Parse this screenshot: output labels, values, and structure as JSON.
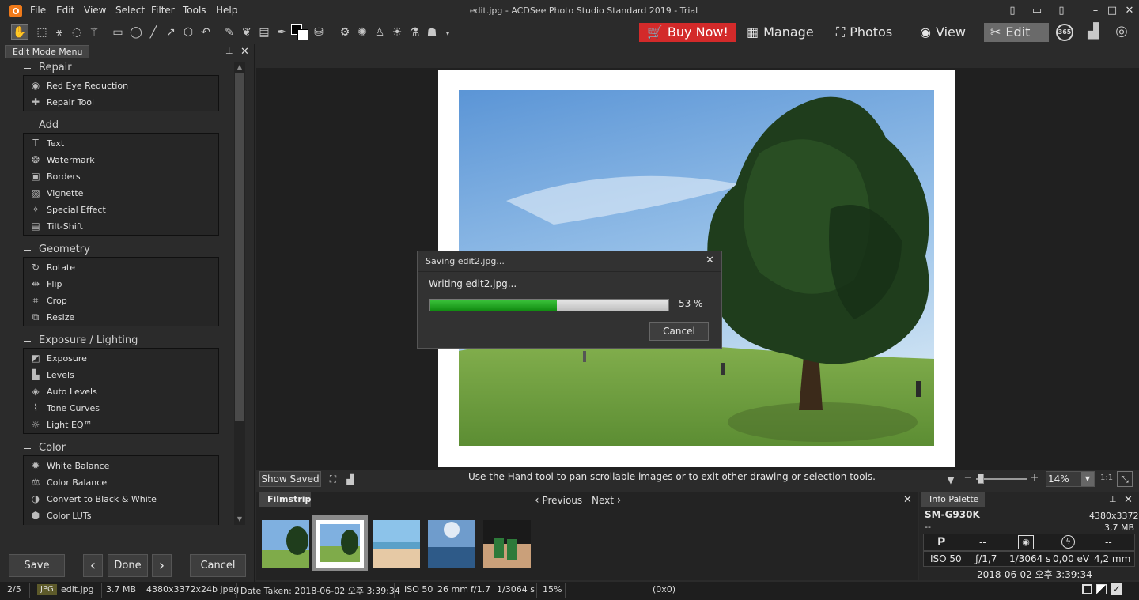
{
  "window": {
    "title": "edit.jpg - ACDSee Photo Studio Standard 2019 - Trial",
    "menu": [
      "File",
      "Edit",
      "View",
      "Select",
      "Filter",
      "Tools",
      "Help"
    ]
  },
  "modes": {
    "buy_now": "Buy Now!",
    "manage": "Manage",
    "photos": "Photos",
    "view": "View",
    "edit": "Edit",
    "badge_365": "365"
  },
  "panel": {
    "tab": "Edit Mode Menu",
    "sections": [
      {
        "title": "Repair",
        "items": [
          {
            "label": "Red Eye Reduction",
            "icon": "eye-icon"
          },
          {
            "label": "Repair Tool",
            "icon": "bandage-icon"
          }
        ]
      },
      {
        "title": "Add",
        "items": [
          {
            "label": "Text",
            "icon": "text-icon"
          },
          {
            "label": "Watermark",
            "icon": "watermark-icon"
          },
          {
            "label": "Borders",
            "icon": "borders-icon"
          },
          {
            "label": "Vignette",
            "icon": "vignette-icon"
          },
          {
            "label": "Special Effect",
            "icon": "wand-icon"
          },
          {
            "label": "Tilt-Shift",
            "icon": "tilt-shift-icon"
          }
        ]
      },
      {
        "title": "Geometry",
        "items": [
          {
            "label": "Rotate",
            "icon": "rotate-icon"
          },
          {
            "label": "Flip",
            "icon": "flip-icon"
          },
          {
            "label": "Crop",
            "icon": "crop-icon"
          },
          {
            "label": "Resize",
            "icon": "resize-icon"
          }
        ]
      },
      {
        "title": "Exposure / Lighting",
        "items": [
          {
            "label": "Exposure",
            "icon": "exposure-icon"
          },
          {
            "label": "Levels",
            "icon": "levels-icon"
          },
          {
            "label": "Auto Levels",
            "icon": "auto-levels-icon"
          },
          {
            "label": "Tone Curves",
            "icon": "tone-curves-icon"
          },
          {
            "label": "Light EQ™",
            "icon": "light-eq-icon"
          }
        ]
      },
      {
        "title": "Color",
        "items": [
          {
            "label": "White Balance",
            "icon": "white-balance-icon"
          },
          {
            "label": "Color Balance",
            "icon": "color-balance-icon"
          },
          {
            "label": "Convert to Black & White",
            "icon": "bw-convert-icon"
          },
          {
            "label": "Color LUTs",
            "icon": "lut-cube-icon"
          }
        ]
      }
    ],
    "buttons": {
      "save": "Save",
      "done": "Done",
      "cancel": "Cancel",
      "prev": "‹",
      "next": "›"
    }
  },
  "dialog": {
    "title": "Saving edit2.jpg...",
    "status": "Writing edit2.jpg...",
    "progress": 0.53,
    "progress_label": "53 %",
    "cancel": "Cancel"
  },
  "canvas_bar": {
    "show_saved": "Show Saved",
    "hint": "Use the Hand tool to pan scrollable images or to exit other drawing or selection tools.",
    "zoom": "14%",
    "one_to_one": "1:1"
  },
  "filmstrip": {
    "tab": "Filmstrip",
    "previous": "Previous",
    "next": "Next",
    "thumbnails": [
      "tree-field",
      "tree-field-framed",
      "beach",
      "sea-sunset",
      "cans-on-table"
    ]
  },
  "info": {
    "tab": "Info Palette",
    "camera": "SM-G930K",
    "dims": "4380x3372",
    "dash": "--",
    "size": "3,7 MB",
    "mode": "P",
    "c2": "--",
    "c5": "--",
    "iso": "ISO 50",
    "aperture": "ƒ/1,7",
    "shutter": "1/3064 s",
    "ev": "0,00 eV",
    "focal": "4,2 mm",
    "date": "2018-06-02 오후 3:39:34"
  },
  "status": {
    "index": "2/5",
    "badge": "JPG",
    "file": "edit.jpg",
    "size": "3.7 MB",
    "format": "4380x3372x24b jpeg",
    "date": "Date Taken: 2018-06-02 오후 3:39:34",
    "iso": "ISO 50",
    "focal": "26 mm",
    "aperture": "f/1.7",
    "shutter": "1/3064 s",
    "zoom": "15%",
    "coords": "(0x0)"
  },
  "colors": {
    "accent_buy": "#d32a2a",
    "progress": "#1fa51f",
    "panel_bg": "#2b2b2b"
  }
}
